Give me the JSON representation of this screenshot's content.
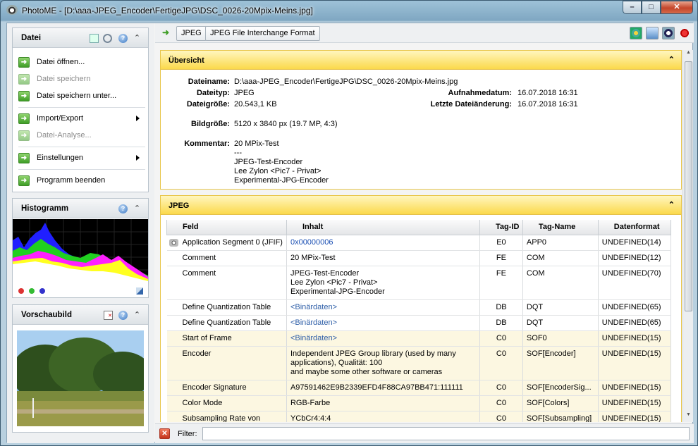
{
  "window": {
    "title": "PhotoME - [D:\\aaa-JPEG_Encoder\\FertigeJPG\\DSC_0026-20Mpix-Meins.jpg]",
    "minimize": "–",
    "maximize": "□",
    "close": "✕"
  },
  "datei": {
    "title": "Datei",
    "items": [
      {
        "label": "Datei öffnen...",
        "enabled": true
      },
      {
        "label": "Datei speichern",
        "enabled": false
      },
      {
        "label": "Datei speichern unter...",
        "enabled": true
      },
      {
        "label": "Import/Export",
        "enabled": true,
        "submenu": true
      },
      {
        "label": "Datei-Analyse...",
        "enabled": false
      },
      {
        "label": "Einstellungen",
        "enabled": true,
        "submenu": true
      },
      {
        "label": "Programm beenden",
        "enabled": true
      }
    ]
  },
  "histogramm": {
    "title": "Histogramm"
  },
  "vorschau": {
    "title": "Vorschaubild"
  },
  "breadcrumb": [
    "JPEG",
    "JPEG File Interchange Format"
  ],
  "uebersicht": {
    "title": "Übersicht",
    "dateiname_label": "Dateiname:",
    "dateiname": "D:\\aaa-JPEG_Encoder\\FertigeJPG\\DSC_0026-20Mpix-Meins.jpg",
    "dateityp_label": "Dateityp:",
    "dateityp": "JPEG",
    "dateigroesse_label": "Dateigröße:",
    "dateigroesse": "20.543,1 KB",
    "aufnahmedatum_label": "Aufnahmedatum:",
    "aufnahmedatum": "16.07.2018 16:31",
    "aenderung_label": "Letzte Dateiänderung:",
    "aenderung": "16.07.2018 16:31",
    "bildgroesse_label": "Bildgröße:",
    "bildgroesse": "5120 x 3840 px (19.7 MP, 4:3)",
    "kommentar_label": "Kommentar:",
    "kommentar": "20 MPix-Test\n---\nJPEG-Test-Encoder\nLee Zylon <Pic7 - Privat>\nExperimental-JPG-Encoder"
  },
  "jpeg": {
    "title": "JPEG",
    "columns": [
      "Feld",
      "Inhalt",
      "Tag-ID",
      "Tag-Name",
      "Datenformat"
    ],
    "rows": [
      {
        "feld": "Application Segment 0 (JFIF)",
        "inhalt": "0x00000006",
        "tag": "E0",
        "name": "APP0",
        "format": "UNDEFINED(14)",
        "style": "link",
        "icon": true
      },
      {
        "feld": "Comment",
        "inhalt": "20 MPix-Test",
        "tag": "FE",
        "name": "COM",
        "format": "UNDEFINED(12)"
      },
      {
        "feld": "Comment",
        "inhalt": "JPEG-Test-Encoder\nLee Zylon <Pic7 - Privat>\nExperimental-JPG-Encoder",
        "tag": "FE",
        "name": "COM",
        "format": "UNDEFINED(70)"
      },
      {
        "feld": "Define Quantization Table",
        "inhalt": "<Binärdaten>",
        "tag": "DB",
        "name": "DQT",
        "format": "UNDEFINED(65)",
        "style": "bin"
      },
      {
        "feld": "Define Quantization Table",
        "inhalt": "<Binärdaten>",
        "tag": "DB",
        "name": "DQT",
        "format": "UNDEFINED(65)",
        "style": "bin"
      },
      {
        "feld": "Start of Frame",
        "inhalt": "<Binärdaten>",
        "tag": "C0",
        "name": "SOF0",
        "format": "UNDEFINED(15)",
        "style": "bin",
        "hl": true
      },
      {
        "feld": "Encoder",
        "inhalt": "Independent JPEG Group library (used by many\napplications), Qualität: 100\nand maybe some other software or cameras",
        "tag": "C0",
        "name": "SOF[Encoder]",
        "format": "UNDEFINED(15)",
        "hl": true
      },
      {
        "feld": "Encoder Signature",
        "inhalt": "A97591462E9B2339EFD4F88CA97BB471:111111",
        "tag": "C0",
        "name": "SOF[EncoderSig...",
        "format": "UNDEFINED(15)",
        "hl": true
      },
      {
        "feld": "Color Mode",
        "inhalt": "RGB-Farbe",
        "tag": "C0",
        "name": "SOF[Colors]",
        "format": "UNDEFINED(15)",
        "hl": true
      },
      {
        "feld": "Subsampling Rate von\nX bis C",
        "inhalt": "YCbCr4:4:4",
        "tag": "C0",
        "name": "SOF[Subsampling]",
        "format": "UNDEFINED(15)",
        "hl": true
      }
    ]
  },
  "filter": {
    "label": "Filter:",
    "value": ""
  }
}
